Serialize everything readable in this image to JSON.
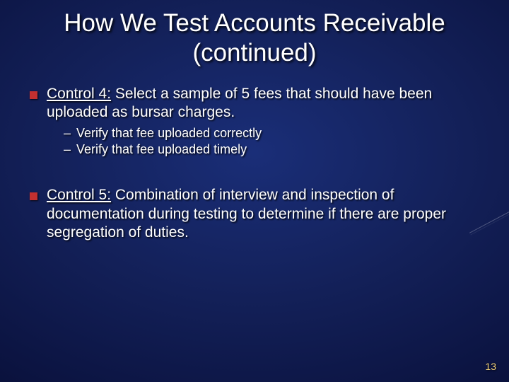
{
  "title": "How We Test Accounts Receivable (continued)",
  "bullets": {
    "b1": {
      "label": "Control 4:",
      "rest": "  Select a sample of 5 fees that should have been uploaded as bursar charges.",
      "sub": {
        "s1": "Verify that fee uploaded correctly",
        "s2": "Verify that fee uploaded timely"
      }
    },
    "b2": {
      "label": "Control 5:",
      "rest": "  Combination of interview and inspection of documentation during testing to determine if there are proper segregation of duties."
    }
  },
  "page_number": "13"
}
